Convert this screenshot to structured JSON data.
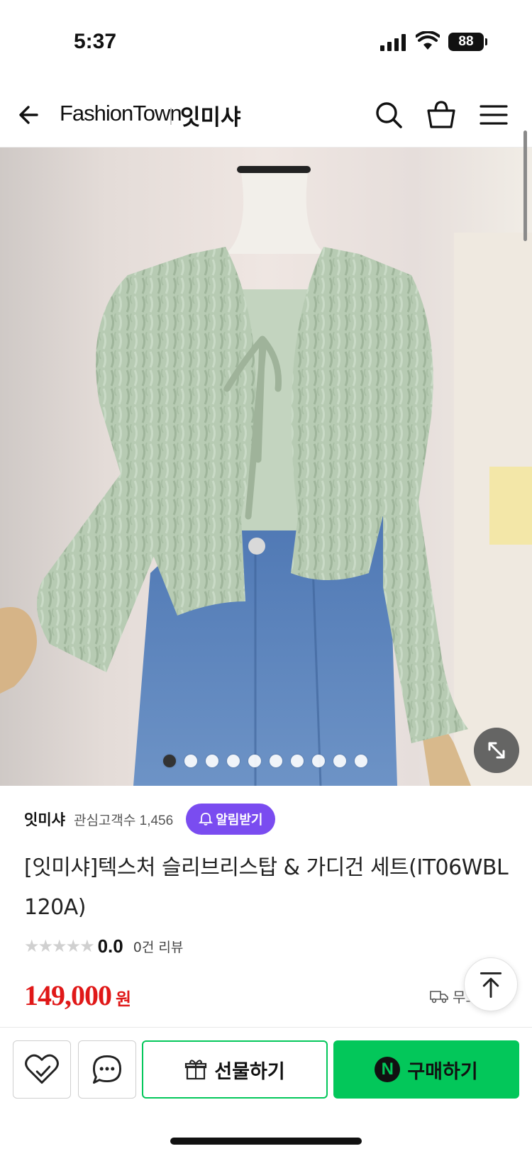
{
  "status_bar": {
    "time": "5:37",
    "battery": "88"
  },
  "header": {
    "brand": "FashionTown",
    "store": "잇미샤",
    "icons": [
      "back-arrow-icon",
      "search-icon",
      "shopping-bag-icon",
      "menu-icon"
    ]
  },
  "gallery": {
    "total_images": 10,
    "active_index": 0
  },
  "seller": {
    "name": "잇미샤",
    "followers": "관심고객수 1,456",
    "notify_label": "알림받기"
  },
  "product": {
    "title": "[잇미샤]텍스처 슬리브리스탑 & 가디건 세트(IT06WBL120A)",
    "rating": "0.0",
    "review_count": "0건 리뷰",
    "price": "149,000",
    "currency": "원",
    "shipping": "무료배송"
  },
  "actions": {
    "gift_label": "선물하기",
    "buy_label": "구매하기",
    "npay_badge": "N"
  },
  "colors": {
    "accent_purple": "#7a4cf0",
    "naver_green": "#03c75a",
    "price_red": "#e01818"
  }
}
